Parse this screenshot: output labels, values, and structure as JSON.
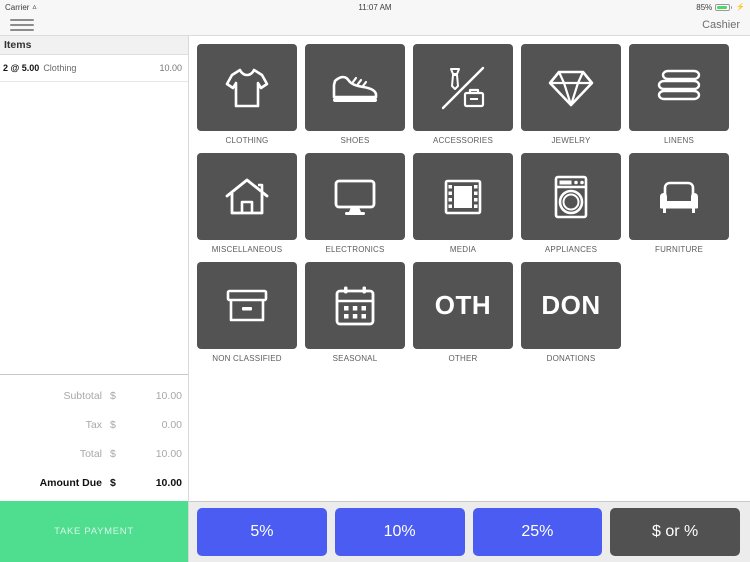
{
  "statusbar": {
    "carrier": "Carrier",
    "wifi_icon": "wifi-icon",
    "time": "11:07 AM",
    "battery_percent": "85%",
    "battery_icon": "battery-icon",
    "charging_icon": "charging-bolt-icon"
  },
  "navbar": {
    "menu_icon": "hamburger-menu-icon",
    "user_role": "Cashier"
  },
  "cart": {
    "header": "Items",
    "items": [
      {
        "qty": "2 @ 5.00",
        "name": "Clothing",
        "amount": "10.00"
      }
    ],
    "totals": [
      {
        "label": "Subtotal",
        "currency": "$",
        "value": "10.00"
      },
      {
        "label": "Tax",
        "currency": "$",
        "value": "0.00"
      },
      {
        "label": "Total",
        "currency": "$",
        "value": "10.00"
      },
      {
        "label": "Amount Due",
        "currency": "$",
        "value": "10.00"
      }
    ],
    "take_payment_label": "TAKE PAYMENT"
  },
  "categories": [
    {
      "label": "CLOTHING",
      "icon": "tshirt-icon"
    },
    {
      "label": "SHOES",
      "icon": "sneaker-icon"
    },
    {
      "label": "ACCESSORIES",
      "icon": "tie-briefcase-icon"
    },
    {
      "label": "JEWELRY",
      "icon": "diamond-icon"
    },
    {
      "label": "LINENS",
      "icon": "folded-towels-icon"
    },
    {
      "label": "MISCELLANEOUS",
      "icon": "house-icon"
    },
    {
      "label": "ELECTRONICS",
      "icon": "monitor-icon"
    },
    {
      "label": "MEDIA",
      "icon": "film-strip-icon"
    },
    {
      "label": "APPLIANCES",
      "icon": "washing-machine-icon"
    },
    {
      "label": "FURNITURE",
      "icon": "sofa-icon"
    },
    {
      "label": "NON CLASSIFIED",
      "icon": "archive-box-icon"
    },
    {
      "label": "SEASONAL",
      "icon": "calendar-icon"
    },
    {
      "label": "OTHER",
      "icon": "text-glyph",
      "text": "OTH"
    },
    {
      "label": "DONATIONS",
      "icon": "text-glyph",
      "text": "DON"
    }
  ],
  "discount_bar": {
    "buttons": [
      {
        "label": "5%",
        "style": "blue"
      },
      {
        "label": "10%",
        "style": "blue"
      },
      {
        "label": "25%",
        "style": "blue"
      },
      {
        "label": "$ or %",
        "style": "gray"
      }
    ]
  },
  "colors": {
    "tile_gray": "#535353",
    "accent_blue": "#4a5cf2",
    "payment_green": "#4fdd8f",
    "battery_green": "#4cd964"
  }
}
